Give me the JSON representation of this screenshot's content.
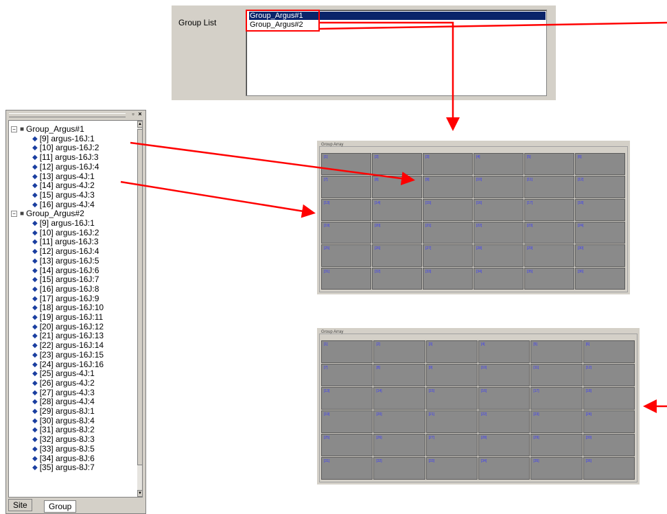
{
  "group_list": {
    "label": "Group List",
    "items": [
      "Group_Argus#1",
      "Group_Argus#2"
    ],
    "selected": "Group_Argus#1"
  },
  "tree": {
    "groups": [
      {
        "name": "Group_Argus#1",
        "channels": [
          "[9] argus-16J:1",
          "[10] argus-16J:2",
          "[11] argus-16J:3",
          "[12] argus-16J:4",
          "[13] argus-4J:1",
          "[14] argus-4J:2",
          "[15] argus-4J:3",
          "[16] argus-4J:4"
        ]
      },
      {
        "name": "Group_Argus#2",
        "channels": [
          "[9] argus-16J:1",
          "[10] argus-16J:2",
          "[11] argus-16J:3",
          "[12] argus-16J:4",
          "[13] argus-16J:5",
          "[14] argus-16J:6",
          "[15] argus-16J:7",
          "[16] argus-16J:8",
          "[17] argus-16J:9",
          "[18] argus-16J:10",
          "[19] argus-16J:11",
          "[20] argus-16J:12",
          "[21] argus-16J:13",
          "[22] argus-16J:14",
          "[23] argus-16J:15",
          "[24] argus-16J:16",
          "[25] argus-4J:1",
          "[26] argus-4J:2",
          "[27] argus-4J:3",
          "[28] argus-4J:4",
          "[29] argus-8J:1",
          "[30] argus-8J:4",
          "[31] argus-8J:2",
          "[32] argus-8J:3",
          "[33] argus-8J:5",
          "[34] argus-8J:6",
          "[35] argus-8J:7"
        ]
      }
    ],
    "tabs": [
      "Site",
      "Group"
    ],
    "active_tab": "Group"
  },
  "grid_panels": [
    {
      "title": "Group Array",
      "cells": [
        [
          "[1]",
          "[2]",
          "[3]",
          "[4]",
          "[5]",
          "[6]"
        ],
        [
          "[7]",
          "[8]",
          "[9]",
          "[10]",
          "[11]",
          "[12]"
        ],
        [
          "[13]",
          "[14]",
          "[15]",
          "[16]",
          "[17]",
          "[18]"
        ],
        [
          "[19]",
          "[20]",
          "[21]",
          "[22]",
          "[23]",
          "[24]"
        ],
        [
          "[25]",
          "[26]",
          "[27]",
          "[28]",
          "[29]",
          "[30]"
        ],
        [
          "[31]",
          "[32]",
          "[33]",
          "[34]",
          "[35]",
          "[36]"
        ]
      ]
    },
    {
      "title": "Group Array",
      "cells": [
        [
          "[1]",
          "[2]",
          "[3]",
          "[4]",
          "[5]",
          "[6]"
        ],
        [
          "[7]",
          "[8]",
          "[9]",
          "[10]",
          "[11]",
          "[12]"
        ],
        [
          "[13]",
          "[14]",
          "[15]",
          "[16]",
          "[17]",
          "[18]"
        ],
        [
          "[19]",
          "[20]",
          "[21]",
          "[22]",
          "[23]",
          "[24]"
        ],
        [
          "[25]",
          "[26]",
          "[27]",
          "[28]",
          "[29]",
          "[30]"
        ],
        [
          "[31]",
          "[32]",
          "[33]",
          "[34]",
          "[35]",
          "[36]"
        ]
      ]
    }
  ],
  "colors": {
    "selection": "#0a246a",
    "annotation": "#ff0000",
    "cell": "#8a8a8a",
    "cell_text": "#3a3aff"
  }
}
